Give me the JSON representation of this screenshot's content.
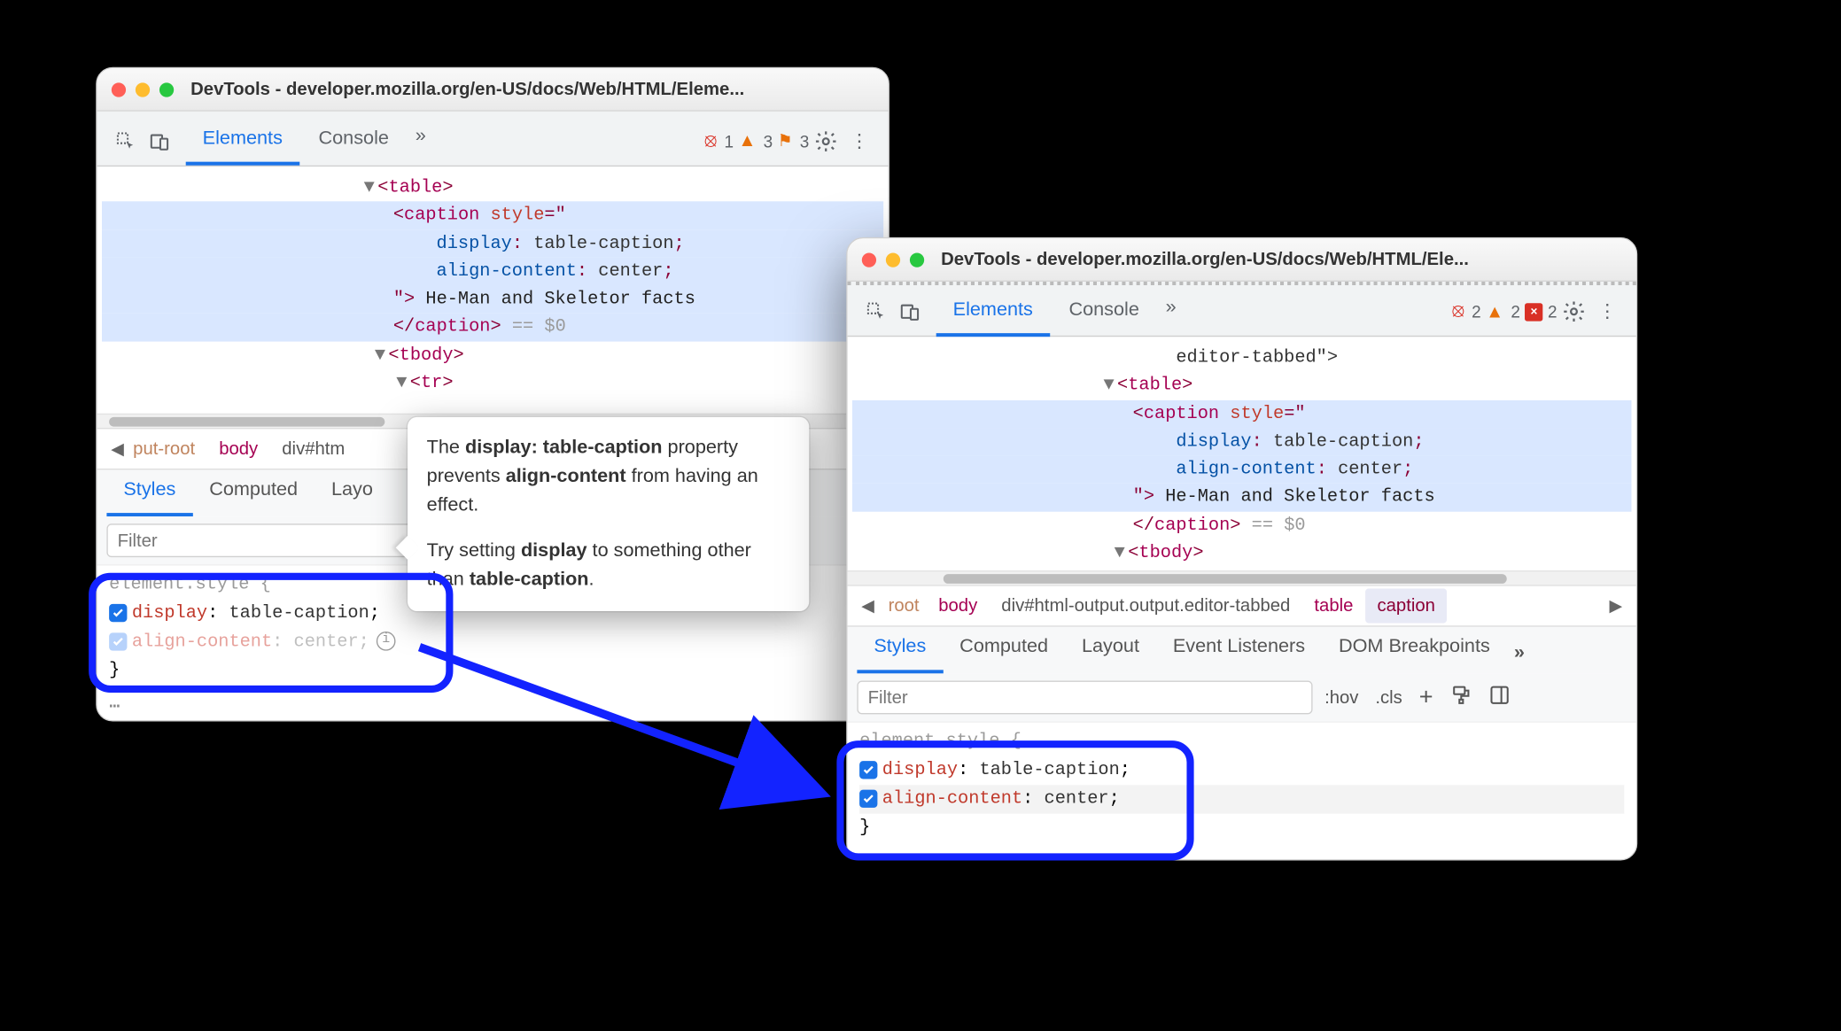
{
  "colors": {
    "accent": "#1a73e8",
    "annotation": "#1323ff",
    "tag": "#a50052",
    "attr": "#c0392b",
    "cssprop": "#0451a5"
  },
  "window1": {
    "title": "DevTools - developer.mozilla.org/en-US/docs/Web/HTML/Eleme...",
    "tabs": {
      "elements": "Elements",
      "console": "Console"
    },
    "badges": {
      "errors": "1",
      "warnings": "3",
      "issues": "3"
    },
    "dom": {
      "table_open": "<table>",
      "caption_open": "<caption",
      "style_attr": "style",
      "display_prop": "display",
      "display_val": "table-caption",
      "align_prop": "align-content",
      "align_val": "center",
      "text": "He-Man and Skeletor facts",
      "caption_close": "</caption>",
      "eq0": "== $0",
      "tbody_open": "<tbody>",
      "tr_open": "<tr>"
    },
    "breadcrumb": {
      "left": "put-root",
      "body": "body",
      "div": "div#htm"
    },
    "subtabs": {
      "styles": "Styles",
      "computed": "Computed",
      "layout": "Layo"
    },
    "filter_placeholder": "Filter",
    "rules": {
      "selector": "element.style {",
      "display_prop": "display",
      "display_val": "table-caption",
      "align_prop": "align-content",
      "align_val": "center",
      "close": "}"
    },
    "tooltip": {
      "line1_a": "The ",
      "line1_b": "display: table-caption",
      "line1_c": " property prevents ",
      "line1_d": "align-content",
      "line1_e": " from having an effect.",
      "line2_a": "Try setting ",
      "line2_b": "display",
      "line2_c": " to something other than ",
      "line2_d": "table-caption",
      "line2_e": "."
    }
  },
  "window2": {
    "title": "DevTools - developer.mozilla.org/en-US/docs/Web/HTML/Ele...",
    "tabs": {
      "elements": "Elements",
      "console": "Console"
    },
    "badges": {
      "errors": "2",
      "warnings": "2",
      "issues": "2"
    },
    "dom": {
      "prefix": "editor-tabbed\">",
      "table_open": "<table>",
      "caption_open": "<caption",
      "style_attr": "style",
      "display_prop": "display",
      "display_val": "table-caption",
      "align_prop": "align-content",
      "align_val": "center",
      "text": "He-Man and Skeletor facts",
      "caption_close": "</caption>",
      "eq0": "== $0",
      "tbody_open": "<tbody>"
    },
    "breadcrumb": {
      "root": "root",
      "body": "body",
      "div": "div#html-output.output.editor-tabbed",
      "table": "table",
      "caption": "caption"
    },
    "subtabs": {
      "styles": "Styles",
      "computed": "Computed",
      "layout": "Layout",
      "events": "Event Listeners",
      "dombp": "DOM Breakpoints"
    },
    "filter_placeholder": "Filter",
    "hov": ":hov",
    "cls": ".cls",
    "rules": {
      "selector": "element.style {",
      "display_prop": "display",
      "display_val": "table-caption",
      "align_prop": "align-content",
      "align_val": "center",
      "close": "}"
    }
  }
}
